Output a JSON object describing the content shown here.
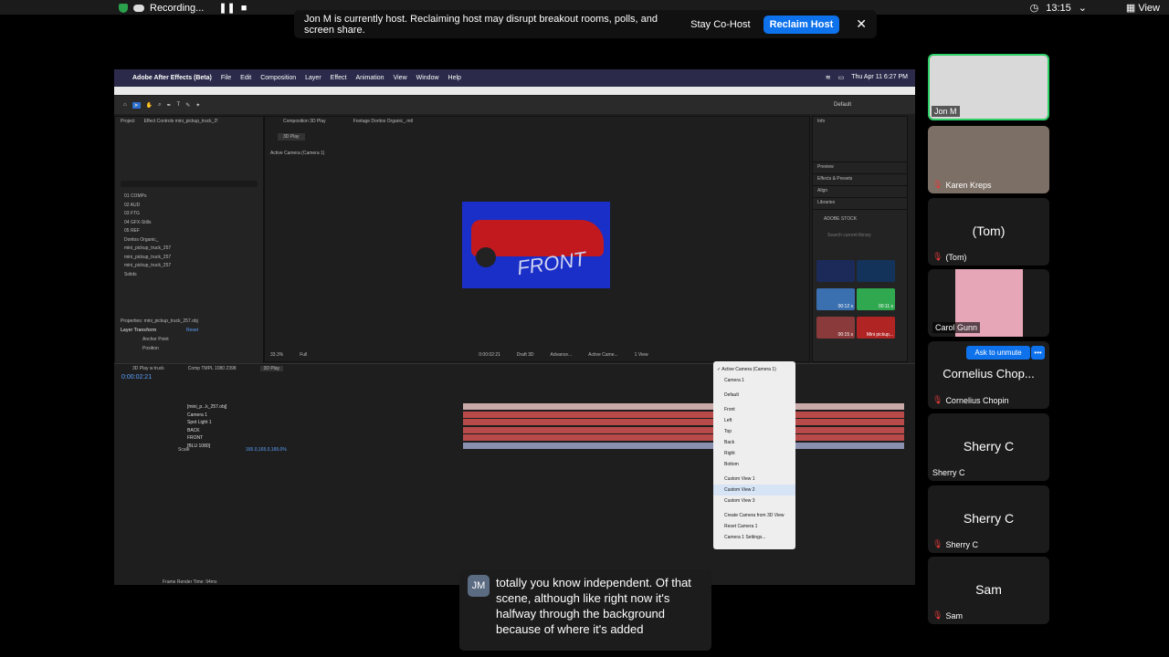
{
  "zoom": {
    "recording_label": "Recording...",
    "time": "13:15",
    "view_label": "View",
    "banner": {
      "message": "Jon M is currently host. Reclaiming host may disrupt breakout rooms, polls, and screen share.",
      "stay_label": "Stay Co-Host",
      "reclaim_label": "Reclaim Host"
    },
    "participants": [
      {
        "name": "Jon M",
        "big": "",
        "muted": false
      },
      {
        "name": "Karen Kreps",
        "big": "",
        "muted": true
      },
      {
        "name": "(Tom)",
        "big": "(Tom)",
        "muted": true
      },
      {
        "name": "Carol Gunn",
        "big": "",
        "muted": false
      },
      {
        "name": "Cornelius Chopin",
        "big": "Cornelius Chop...",
        "muted": true
      },
      {
        "name": "Sherry C",
        "big": "Sherry C",
        "muted": false
      },
      {
        "name": "Sherry C",
        "big": "Sherry C",
        "muted": true
      },
      {
        "name": "Sam",
        "big": "Sam",
        "muted": true
      }
    ],
    "ask_unmute_label": "Ask to unmute",
    "caption": {
      "initials": "JM",
      "text": "totally you know independent. Of that scene, although like right now it's halfway through the background because of where it's added"
    }
  },
  "ae": {
    "mac_app": "Adobe After Effects (Beta)",
    "menu": [
      "File",
      "Edit",
      "Composition",
      "Layer",
      "Effect",
      "Animation",
      "View",
      "Window",
      "Help"
    ],
    "clock": "Thu Apr 11  6:27 PM",
    "workspace": "Default",
    "project_tab": "Project",
    "effect_controls_tab": "Effect Controls mini_pickup_truck_2!",
    "comp_tab": "Composition 3D Play",
    "footage_tab": "Footage Doritos Organic_.mtl",
    "comp_subtab": "3D Play",
    "active_camera": "Active Camera (Camera 1)",
    "project_items": [
      "01 COMPs",
      "02 AUD",
      "03 FTG",
      "04 GFX-Stills",
      "05 REF",
      "Doritos Organic_",
      "mini_pickup_truck_257",
      "mini_pickup_truck_257",
      "mini_pickup_truck_257",
      "Solids"
    ],
    "properties_title": "Properties: mini_pickup_truck_257.obj",
    "layer_transform": "Layer Transform",
    "reset_label": "Reset",
    "anchor_label": "Anchor Point",
    "position_label": "Position",
    "front_text": "FRONT",
    "timecode": "0:00:02:21",
    "timeline_tabs": [
      "3D Play w truck",
      "Comp TMPL 1080 2398",
      "3D Play"
    ],
    "layers": [
      "[mini_p...k_257.obj]",
      "Camera 1",
      "Spot Light 1",
      "BACK",
      "FRONT",
      "[BLU 1080]"
    ],
    "scale_label": "Scale",
    "scale_value": "165.0,165.0,165.0%",
    "right_panels": [
      "Info",
      "Preview",
      "Effects & Presets",
      "Align",
      "Libraries"
    ],
    "adobe_stock": "ADOBE STOCK",
    "search_library": "Search current library",
    "thumb_labels": [
      "00:12 s",
      "00:11 s",
      "00:15 s",
      "Mini pickup..."
    ],
    "camera_menu": [
      "Active Camera (Camera 1)",
      "Camera 1",
      "Default",
      "Front",
      "Left",
      "Top",
      "Back",
      "Right",
      "Bottom",
      "Custom View 1",
      "Custom View 2",
      "Custom View 3",
      "Create Camera from 3D View",
      "Reset Camera 1",
      "Camera 1 Settings..."
    ],
    "frame_render": "Frame Render Time: 94ms",
    "zoom_pct": "33.3%",
    "resolution": "Full",
    "draft": "Draft 3D",
    "renderer": "Advance...",
    "active_cam_dd": "Active Came...",
    "view_count": "1 View"
  }
}
